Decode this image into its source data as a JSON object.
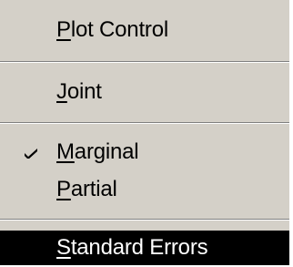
{
  "menu": {
    "items": [
      {
        "mnemonic": "P",
        "rest": "lot Control",
        "checked": false,
        "selected": false
      },
      {
        "mnemonic": "J",
        "rest": "oint",
        "checked": false,
        "selected": false
      },
      {
        "mnemonic": "M",
        "rest": "arginal",
        "checked": true,
        "selected": false
      },
      {
        "mnemonic": "P",
        "rest": "artial",
        "checked": false,
        "selected": false
      },
      {
        "mnemonic": "S",
        "rest": "tandard Errors",
        "checked": false,
        "selected": true
      }
    ]
  },
  "icons": {
    "check": "check-icon"
  },
  "colors": {
    "menu_bg": "#d4d0c8",
    "highlight_bg": "#000000",
    "highlight_text": "#ffffff"
  }
}
